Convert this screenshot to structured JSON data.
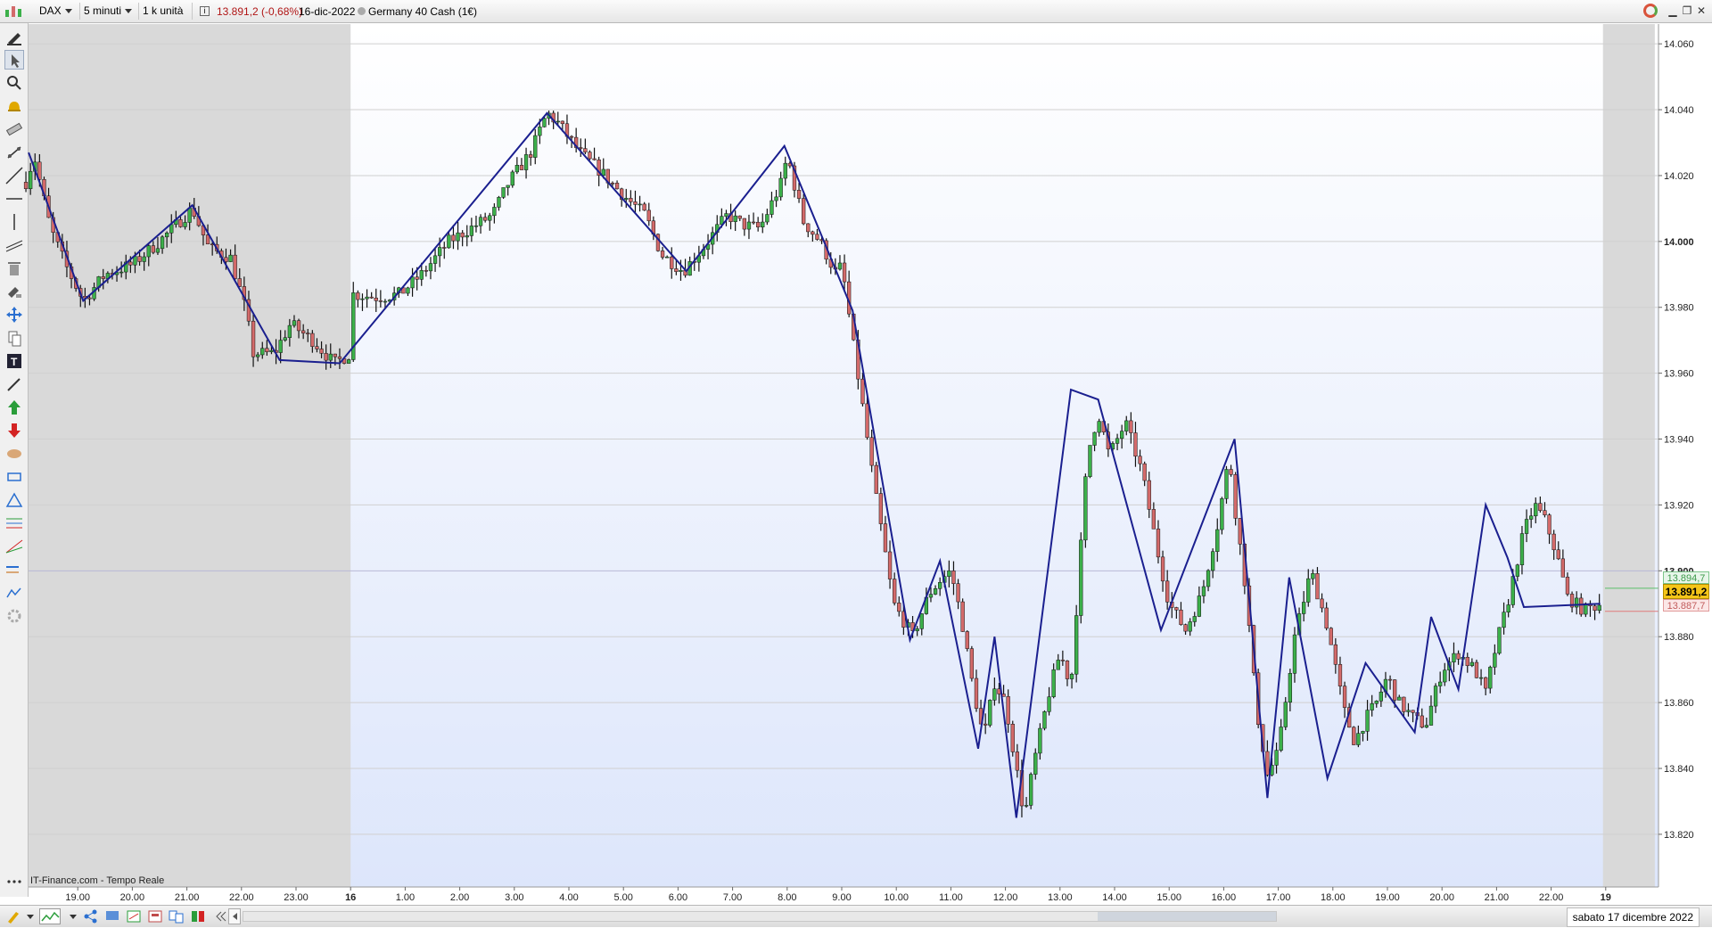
{
  "header": {
    "symbol": "DAX",
    "timeframe": "5 minuti",
    "units": "1 k unità",
    "price_change": "13.891,2 (-0,68%)",
    "date": "16-dic-2022",
    "instrument": "Germany 40 Cash (1€)",
    "info_icon": "info-icon"
  },
  "prices": {
    "last": "13.891,2",
    "ask": "13.894,7",
    "bid": "13.887,7"
  },
  "source": "IT-Finance.com - Tempo Reale",
  "footer": {
    "date_label": "sabato 17 dicembre 2022"
  },
  "colors": {
    "up": "#3cb04a",
    "down": "#d36a6a",
    "zigzag": "#1a1f8f",
    "session_off": "#d9d9d9",
    "session_on_top": "#ffffff",
    "session_on_bottom": "#dde6fb",
    "highlight_label": "#f5c518"
  },
  "chart_data": {
    "type": "candlestick",
    "title": "",
    "xlabel": "",
    "ylabel": "",
    "ylim": [
      13804,
      14066
    ],
    "y_ticks": [
      13820,
      13840,
      13860,
      13880,
      13900,
      13920,
      13940,
      13960,
      13980,
      14000,
      14020,
      14040,
      14060
    ],
    "y_tick_labels": [
      "13.820",
      "13.840",
      "13.860",
      "13.880",
      "13.900",
      "13.920",
      "13.940",
      "13.960",
      "13.980",
      "14.000",
      "14.020",
      "14.040",
      "14.060"
    ],
    "x_ticks": [
      "19.00",
      "20.00",
      "21.00",
      "22.00",
      "23.00",
      "16",
      "1.00",
      "2.00",
      "3.00",
      "4.00",
      "5.00",
      "6.00",
      "7.00",
      "8.00",
      "9.00",
      "10.00",
      "11.00",
      "12.00",
      "13.00",
      "14.00",
      "15.00",
      "16.00",
      "17.00",
      "18.00",
      "19.00",
      "20.00",
      "21.00",
      "22.00",
      "19"
    ],
    "x_tick_values": [
      19,
      20,
      21,
      22,
      23,
      24,
      25,
      26,
      27,
      28,
      29,
      30,
      31,
      32,
      33,
      34,
      35,
      36,
      37,
      38,
      39,
      40,
      41,
      42,
      43,
      44,
      45,
      46,
      47
    ],
    "x_range": [
      18.0,
      47.9
    ],
    "session_shading": [
      [
        18.0,
        24.0
      ],
      [
        46.95,
        47.9
      ]
    ],
    "price_path": [
      [
        18.05,
        14018
      ],
      [
        18.2,
        14026
      ],
      [
        18.5,
        14004
      ],
      [
        18.8,
        13992
      ],
      [
        19.1,
        13982
      ],
      [
        19.5,
        13990
      ],
      [
        20.0,
        13993
      ],
      [
        20.5,
        14000
      ],
      [
        21.1,
        14010
      ],
      [
        21.4,
        13998
      ],
      [
        21.8,
        13995
      ],
      [
        22.1,
        13978
      ],
      [
        22.2,
        13966
      ],
      [
        22.6,
        13966
      ],
      [
        22.9,
        13975
      ],
      [
        23.3,
        13970
      ],
      [
        23.7,
        13963
      ],
      [
        24.0,
        13966
      ],
      [
        24.05,
        13984
      ],
      [
        24.5,
        13983
      ],
      [
        24.9,
        13984
      ],
      [
        25.3,
        13990
      ],
      [
        25.8,
        14000
      ],
      [
        26.3,
        14005
      ],
      [
        26.6,
        14008
      ],
      [
        26.9,
        14018
      ],
      [
        27.3,
        14027
      ],
      [
        27.6,
        14039
      ],
      [
        27.8,
        14036
      ],
      [
        28.2,
        14027
      ],
      [
        28.6,
        14021
      ],
      [
        29.0,
        14014
      ],
      [
        29.4,
        14008
      ],
      [
        29.7,
        13996
      ],
      [
        30.1,
        13991
      ],
      [
        30.5,
        13999
      ],
      [
        30.9,
        14008
      ],
      [
        31.2,
        14005
      ],
      [
        31.5,
        14004
      ],
      [
        31.9,
        14018
      ],
      [
        32.0,
        14026
      ],
      [
        32.3,
        14006
      ],
      [
        32.6,
        14000
      ],
      [
        32.9,
        13990
      ],
      [
        33.0,
        13993
      ],
      [
        33.2,
        13970
      ],
      [
        33.4,
        13948
      ],
      [
        33.6,
        13925
      ],
      [
        33.8,
        13905
      ],
      [
        33.95,
        13890
      ],
      [
        34.3,
        13880
      ],
      [
        34.6,
        13893
      ],
      [
        34.8,
        13897
      ],
      [
        35.0,
        13900
      ],
      [
        35.2,
        13885
      ],
      [
        35.4,
        13865
      ],
      [
        35.6,
        13849
      ],
      [
        35.8,
        13866
      ],
      [
        36.0,
        13860
      ],
      [
        36.2,
        13840
      ],
      [
        36.35,
        13825
      ],
      [
        36.5,
        13840
      ],
      [
        36.8,
        13863
      ],
      [
        37.0,
        13875
      ],
      [
        37.2,
        13865
      ],
      [
        37.5,
        13935
      ],
      [
        37.7,
        13948
      ],
      [
        37.9,
        13935
      ],
      [
        38.2,
        13945
      ],
      [
        38.5,
        13930
      ],
      [
        38.8,
        13905
      ],
      [
        39.0,
        13890
      ],
      [
        39.3,
        13882
      ],
      [
        39.6,
        13893
      ],
      [
        39.9,
        13915
      ],
      [
        40.1,
        13935
      ],
      [
        40.2,
        13920
      ],
      [
        40.4,
        13895
      ],
      [
        40.6,
        13858
      ],
      [
        40.8,
        13838
      ],
      [
        41.0,
        13845
      ],
      [
        41.3,
        13880
      ],
      [
        41.6,
        13900
      ],
      [
        41.9,
        13883
      ],
      [
        42.2,
        13858
      ],
      [
        42.4,
        13848
      ],
      [
        42.6,
        13855
      ],
      [
        42.8,
        13860
      ],
      [
        43.0,
        13868
      ],
      [
        43.2,
        13860
      ],
      [
        43.5,
        13855
      ],
      [
        43.7,
        13853
      ],
      [
        44.0,
        13870
      ],
      [
        44.3,
        13875
      ],
      [
        44.6,
        13870
      ],
      [
        44.8,
        13863
      ],
      [
        45.0,
        13878
      ],
      [
        45.2,
        13890
      ],
      [
        45.5,
        13912
      ],
      [
        45.7,
        13920
      ],
      [
        45.9,
        13915
      ],
      [
        46.1,
        13905
      ],
      [
        46.3,
        13892
      ],
      [
        46.6,
        13888
      ],
      [
        46.9,
        13890
      ]
    ],
    "zigzag": [
      [
        18.1,
        14027
      ],
      [
        19.1,
        13982
      ],
      [
        21.1,
        14011
      ],
      [
        22.7,
        13964
      ],
      [
        23.8,
        13963
      ],
      [
        27.6,
        14039
      ],
      [
        30.15,
        13991
      ],
      [
        31.95,
        14029
      ],
      [
        33.2,
        13979
      ],
      [
        34.25,
        13879
      ],
      [
        34.8,
        13903
      ],
      [
        35.5,
        13846
      ],
      [
        35.8,
        13880
      ],
      [
        36.2,
        13825
      ],
      [
        37.2,
        13955
      ],
      [
        37.7,
        13952
      ],
      [
        38.85,
        13882
      ],
      [
        40.2,
        13940
      ],
      [
        40.8,
        13831
      ],
      [
        41.2,
        13898
      ],
      [
        41.9,
        13837
      ],
      [
        42.6,
        13872
      ],
      [
        43.5,
        13851
      ],
      [
        43.8,
        13886
      ],
      [
        44.3,
        13864
      ],
      [
        44.8,
        13920
      ],
      [
        45.2,
        13904
      ],
      [
        45.5,
        13889
      ],
      [
        46.9,
        13890
      ]
    ],
    "ask": 13894.7,
    "bid": 13887.7,
    "last": 13891.2,
    "grid": true,
    "legend": "none"
  }
}
